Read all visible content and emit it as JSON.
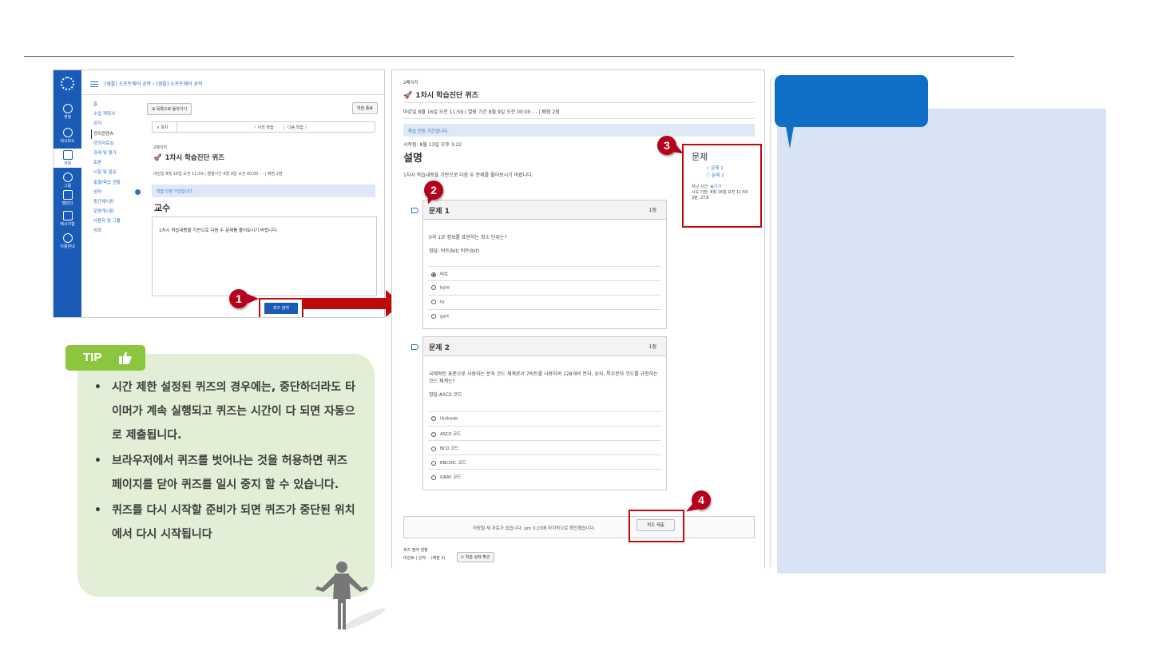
{
  "left_screen": {
    "breadcrumb": "[샘플] 소프트웨어 공학 › [샘플] 소프트웨어 공학",
    "global_nav": [
      "계정",
      "대시보드",
      "과목",
      "그룹",
      "캘린더",
      "메시지함",
      "이용안내"
    ],
    "course_nav": [
      "홈",
      "수업 계획서",
      "공지",
      "강의콘텐츠",
      "강의자료실",
      "과제 및 평가",
      "토론",
      "시험 및 설문",
      "출결/학습 현황",
      "성적",
      "중간제시판",
      "운영게시판",
      "사용자 및 그룹",
      "성과"
    ],
    "active_nav_index": 3,
    "study_end": "학습 종료",
    "sidebar_toggle": "⊞ 목록으로 돌아가기",
    "nav_toggle": "∨ 목차",
    "prev": "〈 이전 학습",
    "next": "다음 학습 〉",
    "page_label": "2페이지",
    "quiz_title": "1차시 학습진단 퀴즈",
    "meta": "마감일 8월 16일 오전 11:59 | 열람기간 8월 9일 오전 00:00 - - | 배점 2점",
    "banner": "학습 인정 기간입니다.",
    "section_heading": "교수",
    "description": "1차시 학습내용을 기반으로 다음 두 문제를 풀어보시기 바랍니다.",
    "take_quiz": "퀴즈 참여"
  },
  "tip": {
    "label": "TIP",
    "items": [
      "시간 제한 설정된 퀴즈의 경우에는, 중단하더라도 타이머가 계속 실행되고 퀴즈는 시간이 다 되면 자동으로 제출됩니다.",
      "브라우저에서 퀴즈를 벗어나는 것을 허용하면 퀴즈 페이지를 닫아 퀴즈를 일시 중지 할 수 있습니다.",
      "퀴즈를 다시 시작할 준비가 되면 퀴즈가 중단된 위치에서 다시 시작됩니다"
    ]
  },
  "right_screen": {
    "page_label": "2페이지",
    "quiz_title": "1차시 학습진단 퀴즈",
    "meta": "마감일 8월 16일 오전 11:59 | 열람 기간 8월 9일 오전 00:00 - - | 배점 2점",
    "banner": "학습 인정 기간입니다.",
    "started": "시작됨: 8월 13일 오후 3:22",
    "heading": "설명",
    "description": "1차시 학습내용을 기반으로 다음 두 문제를 풀어보시기 바랍니다.",
    "questions": [
      {
        "title": "문제 1",
        "points": "1점",
        "text": "0과 1로 정보를 표현하는 최소 단위는?",
        "answer_hint": "정답: 비트/bit/ 비트(bit)",
        "options": [
          "비트",
          "byte",
          "to",
          "gart"
        ],
        "selected": 0
      },
      {
        "title": "문제 2",
        "points": "1점",
        "text": "국제적인 표준으로 사용하는 문자 코드 체계로서 7비트를 사용하여 128개의 문자, 숫자, 특수문자 코드를 규정하는 코드 체계는?",
        "answer_hint": "정답:ASCII 코드",
        "options": [
          "Unikode",
          "ASCII 코드",
          "BCD 코드",
          "EBCDIC 코드",
          "GRAY 코드"
        ],
        "selected": -1
      }
    ],
    "side": {
      "heading": "문제",
      "links": [
        "✓ 문제 1",
        "ⓘ 문제 2"
      ],
      "time_label": "지난 시간:",
      "time_toggle": "숨기기",
      "try_label": "시도 기한: 8월 16일 오전 11:59",
      "elapsed": "3분, 27초"
    },
    "save_note": "저장될 새 자료가 없습니다. pm 3:23에 마지막으로 확인했습니다.",
    "submit": "퀴즈 제출",
    "status_label": "퀴즈 참여 현황",
    "status_text": "미완료 | 성적: - (배점 2)",
    "check_button": "학습 상태 확인"
  },
  "badges": [
    "1",
    "2",
    "3",
    "4"
  ],
  "colors": {
    "accent_red": "#c0090a",
    "badge_red": "#b5001d",
    "nav_blue": "#1a5bb8",
    "tip_green": "#8cc63e",
    "tip_bg": "#e2efd6",
    "panel_blue": "#0f6fc6",
    "panel_bg": "#d8e3f3"
  }
}
